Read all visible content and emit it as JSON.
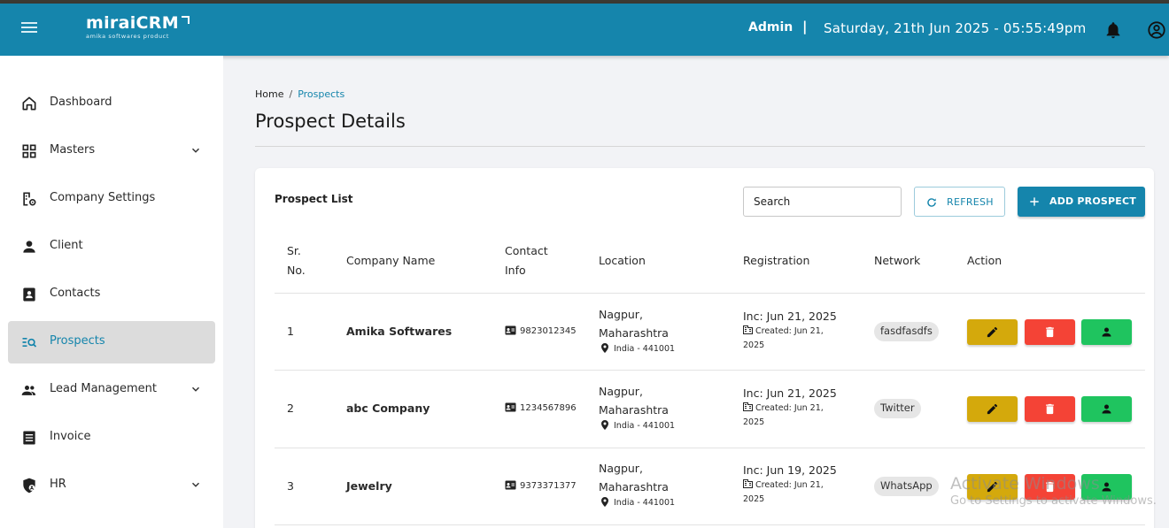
{
  "app": {
    "logo_text": "miraiCRM",
    "logo_tagline": "amika softwares product",
    "user_label": "Admin",
    "separator": "|",
    "datetime": "Saturday, 21th Jun 2025 - 05:55:49pm"
  },
  "sidebar": {
    "items": [
      {
        "label": "Dashboard",
        "icon": "home-icon"
      },
      {
        "label": "Masters",
        "icon": "grid-icon",
        "expandable": true
      },
      {
        "label": "Company Settings",
        "icon": "building-gear-icon"
      },
      {
        "label": "Client",
        "icon": "person-icon"
      },
      {
        "label": "Contacts",
        "icon": "contact-card-icon"
      },
      {
        "label": "Prospects",
        "icon": "list-search-icon",
        "active": true
      },
      {
        "label": "Lead Management",
        "icon": "people-icon",
        "expandable": true
      },
      {
        "label": "Invoice",
        "icon": "receipt-icon"
      },
      {
        "label": "HR",
        "icon": "shield-person-icon",
        "expandable": true
      }
    ]
  },
  "breadcrumb": {
    "home": "Home",
    "separator": "/",
    "current": "Prospects"
  },
  "page": {
    "title": "Prospect Details"
  },
  "prospect_list": {
    "title": "Prospect List",
    "search_placeholder": "Search",
    "refresh_label": "REFRESH",
    "add_label": "ADD PROSPECT",
    "columns": {
      "sr_line1": "Sr.",
      "sr_line2": "No.",
      "company": "Company Name",
      "contact_line1": "Contact",
      "contact_line2": "Info",
      "location": "Location",
      "registration": "Registration",
      "network": "Network",
      "action": "Action"
    },
    "rows": [
      {
        "sr": "1",
        "company": "Amika Softwares",
        "phone": "9823012345",
        "city": "Nagpur,",
        "state": "Maharashtra",
        "country": "India - 441001",
        "inc": "Inc: Jun 21, 2025",
        "created_1": "Created: Jun 21,",
        "created_2": "2025",
        "network": "fasdfasdfs"
      },
      {
        "sr": "2",
        "company": "abc Company",
        "phone": "1234567896",
        "city": "Nagpur,",
        "state": "Maharashtra",
        "country": "India - 441001",
        "inc": "Inc: Jun 21, 2025",
        "created_1": "Created: Jun 21,",
        "created_2": "2025",
        "network": "Twitter"
      },
      {
        "sr": "3",
        "company": "Jewelry",
        "phone": "9373371377",
        "city": "Nagpur,",
        "state": "Maharashtra",
        "country": "India - 441001",
        "inc": "Inc: Jun 19, 2025",
        "created_1": "Created: Jun 21,",
        "created_2": "2025",
        "network": "WhatsApp"
      }
    ]
  },
  "watermark": {
    "line1": "Activate Windows",
    "line2": "Go to Settings to activate Windows."
  },
  "colors": {
    "primary": "#1585ac",
    "edit": "#d4a90c",
    "delete": "#f44336",
    "convert": "#1fc45f"
  }
}
